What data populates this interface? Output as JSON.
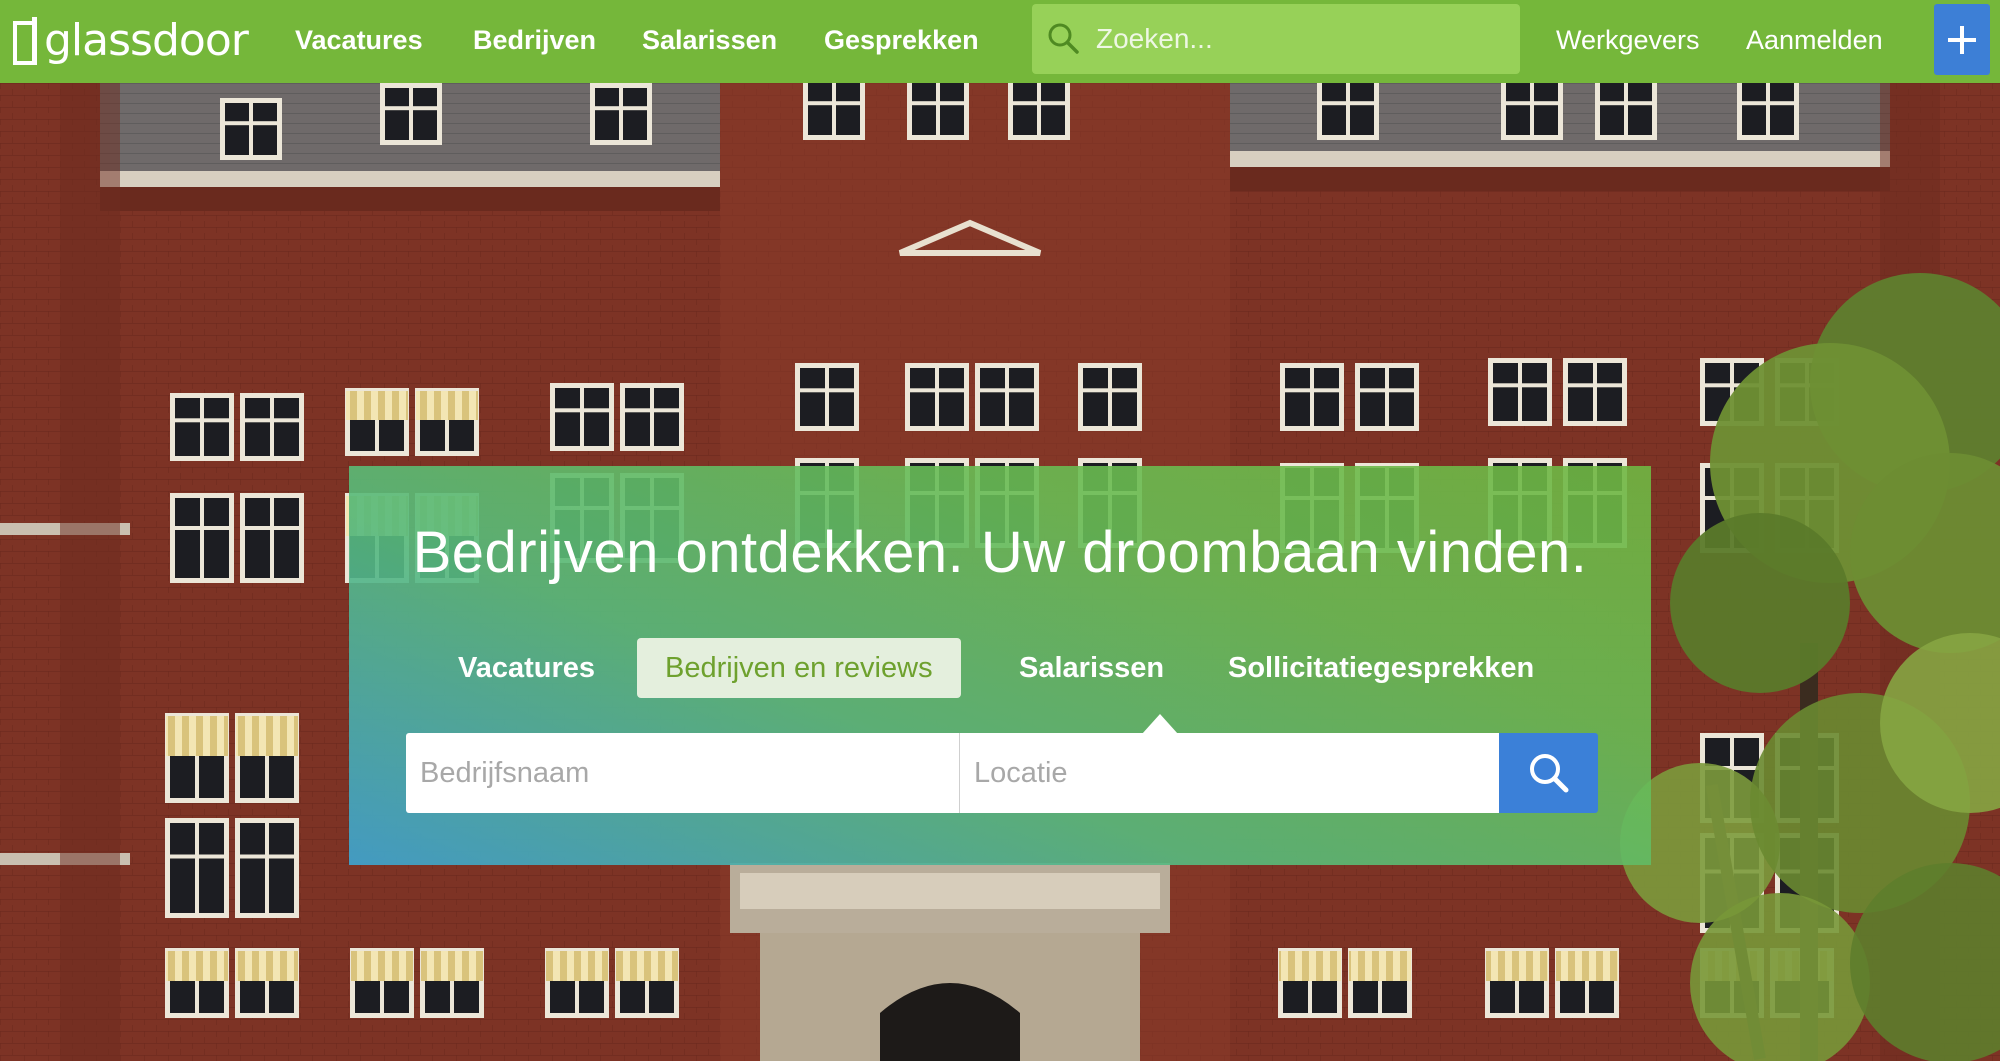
{
  "brand": {
    "name": "glassdoor"
  },
  "topnav": {
    "items": [
      {
        "label": "Vacatures"
      },
      {
        "label": "Bedrijven"
      },
      {
        "label": "Salarissen"
      },
      {
        "label": "Gesprekken"
      }
    ],
    "search_placeholder": "Zoeken...",
    "employers_label": "Werkgevers",
    "signin_label": "Aanmelden",
    "plus_icon": "plus-icon"
  },
  "hero": {
    "headline": "Bedrijven ontdekken. Uw droombaan vinden.",
    "tabs": [
      {
        "label": "Vacatures",
        "active": false
      },
      {
        "label": "Bedrijven en reviews",
        "active": true
      },
      {
        "label": "Salarissen",
        "active": false
      },
      {
        "label": "Sollicitatiegesprekken",
        "active": false
      }
    ],
    "company_placeholder": "Bedrijfsnaam",
    "location_placeholder": "Locatie",
    "search_icon": "search-icon"
  },
  "colors": {
    "brand_green": "#75b73a",
    "nav_search_bg": "#97d158",
    "accent_blue": "#3b80d8",
    "active_tab_bg": "#e4efdd",
    "active_tab_text": "#6ea12e"
  }
}
